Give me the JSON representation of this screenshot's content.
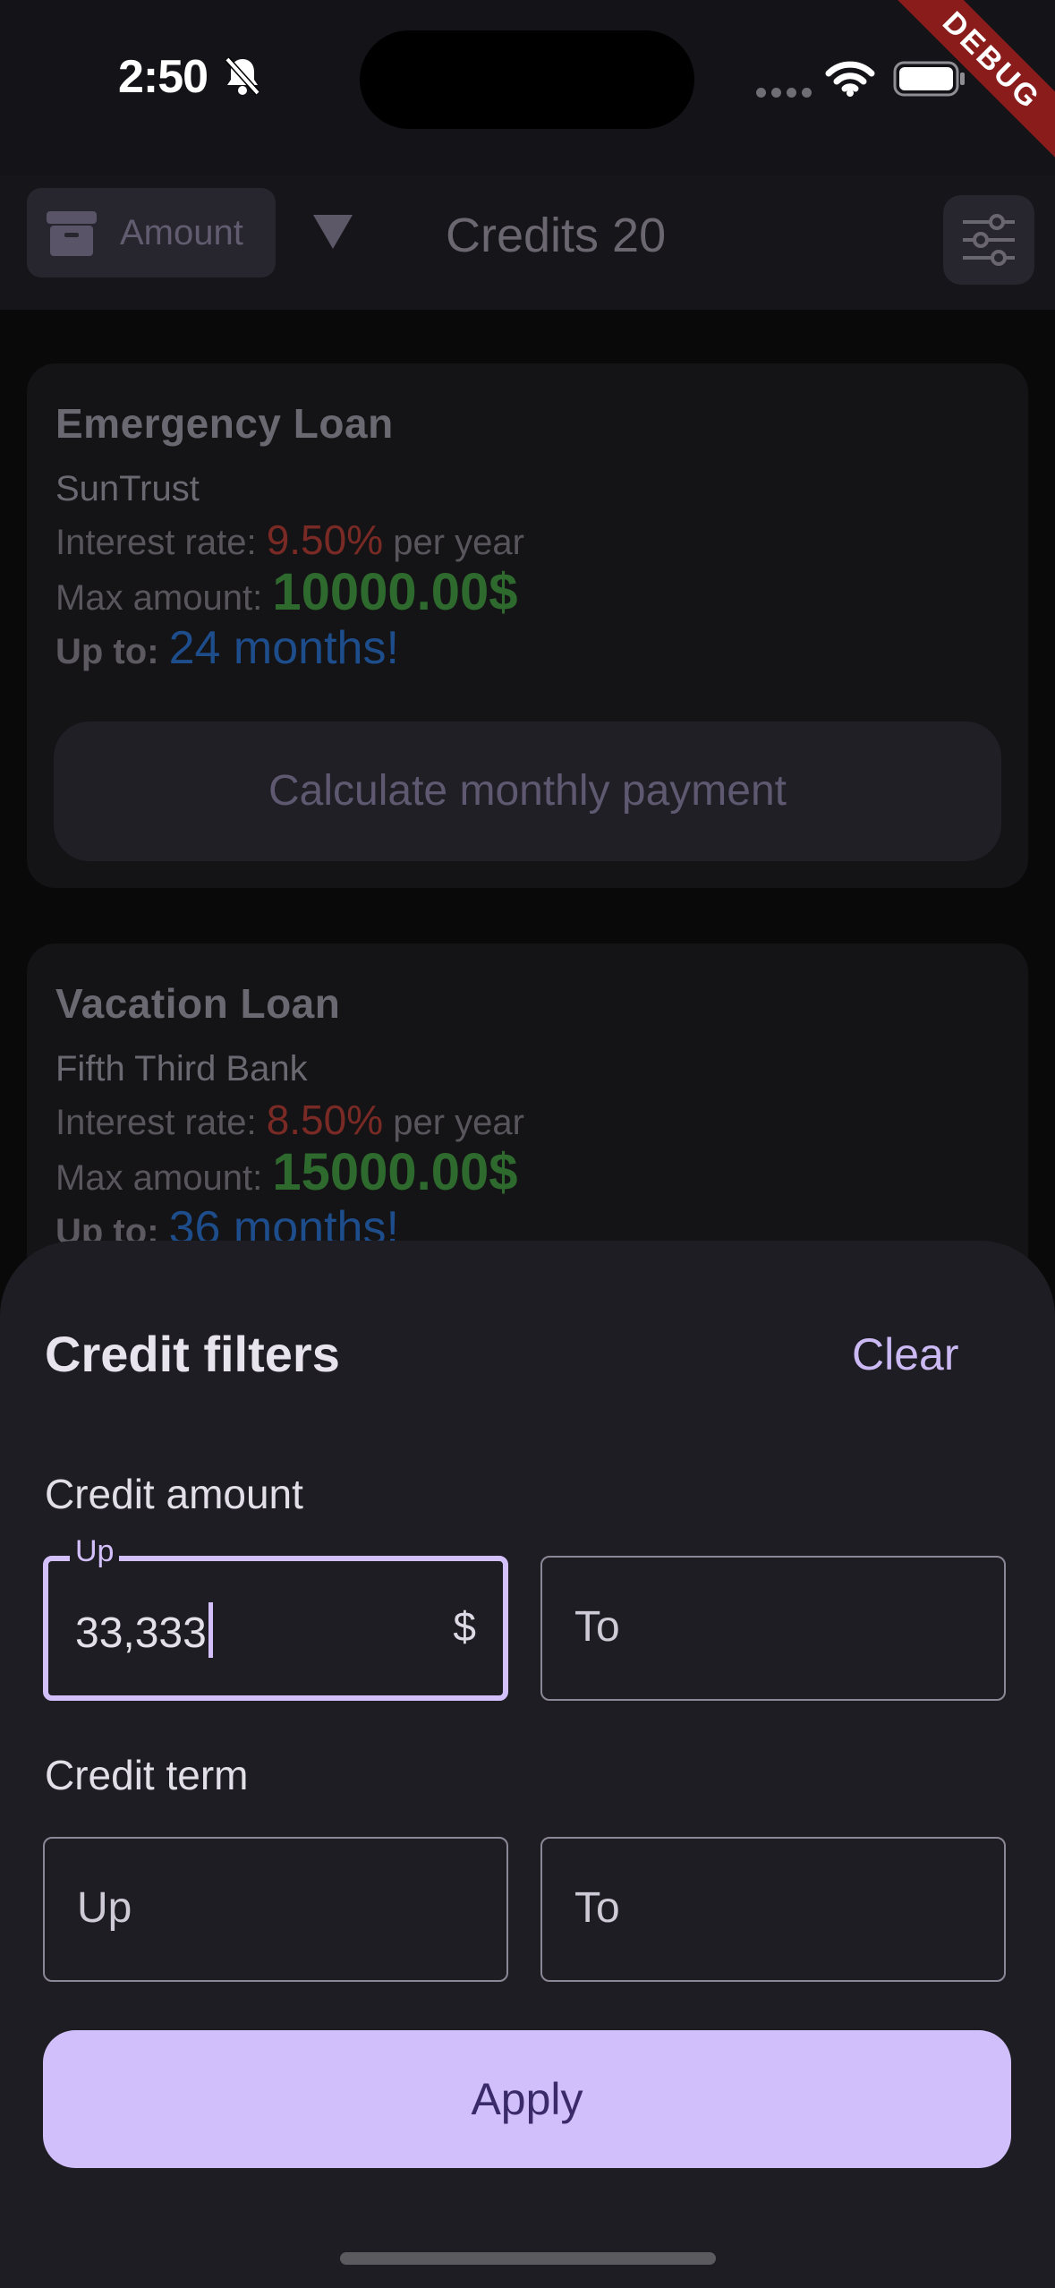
{
  "status_bar": {
    "time": "2:50",
    "icons": [
      "bell-off-icon",
      "signal-dots-icon",
      "wifi-icon",
      "battery-icon"
    ],
    "debug_banner": "DEBUG"
  },
  "app_bar": {
    "sort_chip_label": "Amount",
    "title": "Credits 20"
  },
  "loans": [
    {
      "title": "Emergency Loan",
      "bank": "SunTrust",
      "interest_label": "Interest rate:",
      "interest_value": "9.50%",
      "interest_suffix": "per year",
      "max_label": "Max amount:",
      "max_value": "10000.00$",
      "upto_label": "Up to:",
      "upto_value": "24 months!",
      "button_label": "Calculate monthly payment"
    },
    {
      "title": "Vacation Loan",
      "bank": "Fifth Third Bank",
      "interest_label": "Interest rate:",
      "interest_value": "8.50%",
      "interest_suffix": "per year",
      "max_label": "Max amount:",
      "max_value": "15000.00$",
      "upto_label": "Up to:",
      "upto_value": "36 months!"
    }
  ],
  "filters_sheet": {
    "title": "Credit filters",
    "clear_label": "Clear",
    "amount_section": "Credit amount",
    "amount_from": {
      "label": "Up",
      "value": "33,333",
      "suffix": "$"
    },
    "amount_to": {
      "placeholder": "To"
    },
    "term_section": "Credit term",
    "term_from": {
      "placeholder": "Up"
    },
    "term_to": {
      "placeholder": "To"
    },
    "apply_label": "Apply"
  },
  "colors": {
    "accent": "#d1bffb",
    "interest_red": "#7a2a24",
    "amount_green": "#2e6a2e",
    "months_blue": "#1e4d8c",
    "sheet_bg": "#1e1d23"
  }
}
